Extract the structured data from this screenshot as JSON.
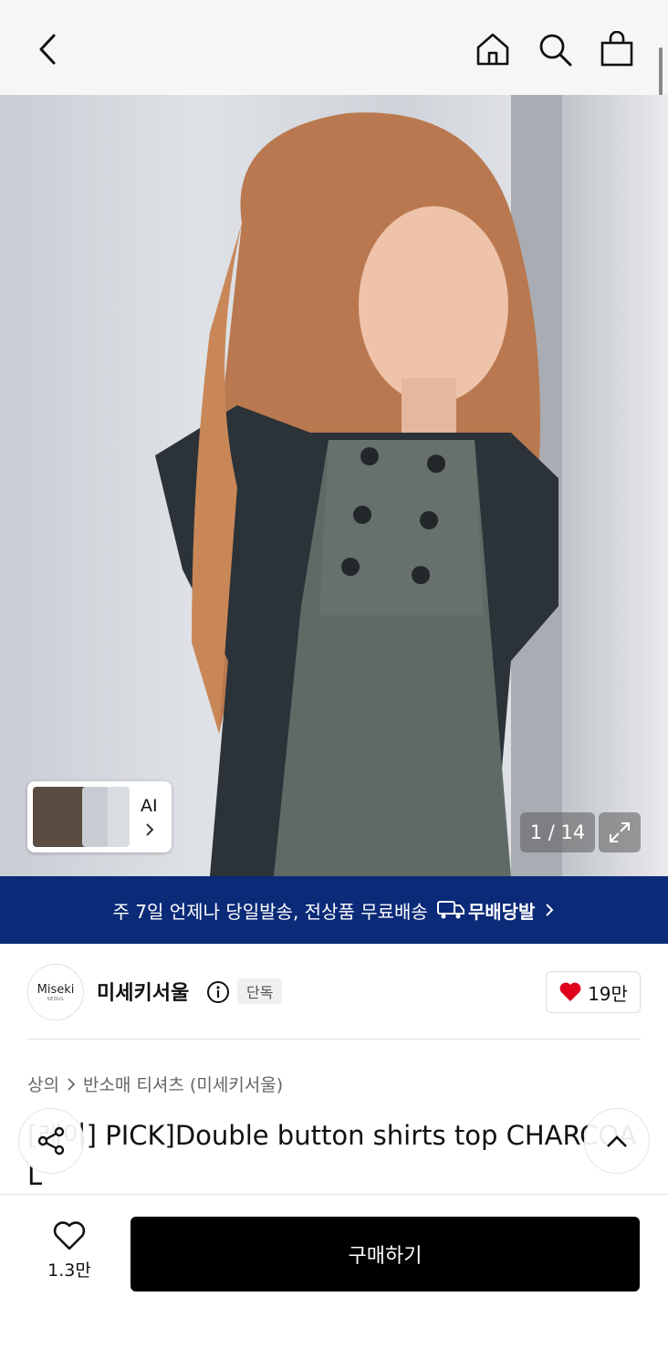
{
  "hero": {
    "counter": "1 / 14",
    "ai_label": "AI"
  },
  "banner": {
    "text": "주 7일 언제나 당일발송, 전상품 무료배송",
    "brand": "무배당발"
  },
  "seller": {
    "logo_text": "Miseki",
    "logo_sub": "SEOUL",
    "name": "미세키서울",
    "badge": "단독",
    "like_count": "19만"
  },
  "breadcrumb": {
    "category": "상의",
    "subcategory": "반소매 티셔츠 (미세키서울)"
  },
  "product": {
    "title": "[레이] PICK]Double button shirts top CHARCOAL"
  },
  "bottom": {
    "wish_count": "1.3만",
    "buy_label": "구매하기"
  },
  "colors": {
    "banner_bg": "#0b2a78",
    "heart": "#e0001b",
    "buy_bg": "#000000"
  }
}
